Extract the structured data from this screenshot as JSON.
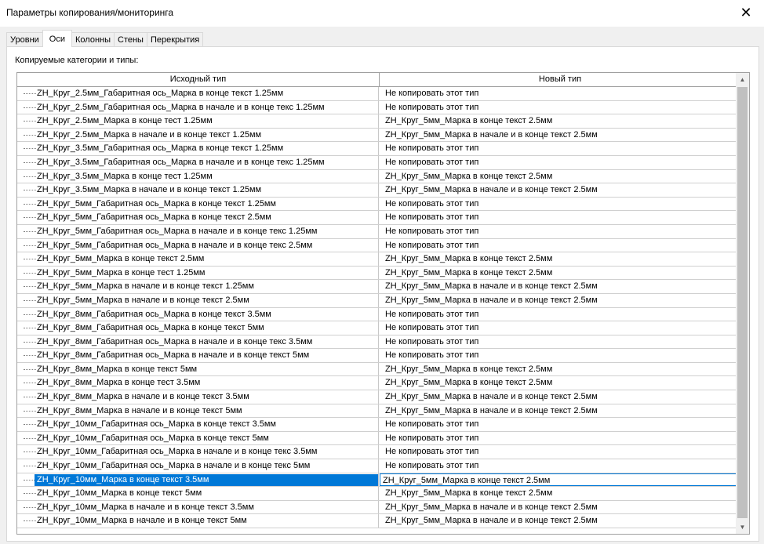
{
  "window": {
    "title": "Параметры копирования/мониторинга",
    "close_glyph": "✕"
  },
  "tabs": [
    {
      "label": "Уровни"
    },
    {
      "label": "Оси"
    },
    {
      "label": "Колонны"
    },
    {
      "label": "Стены"
    },
    {
      "label": "Перекрытия"
    }
  ],
  "active_tab": "Оси",
  "section_label": "Копируемые категории и типы:",
  "grid": {
    "columns": [
      "Исходный тип",
      "Новый тип"
    ],
    "rows": [
      [
        "ZH_Круг_2.5мм_Габаритная ось_Марка в конце текст 1.25мм",
        "Не копировать этот тип"
      ],
      [
        "ZH_Круг_2.5мм_Габаритная ось_Марка в начале и в конце текс 1.25мм",
        "Не копировать этот тип"
      ],
      [
        "ZH_Круг_2.5мм_Марка в конце тест 1.25мм",
        "ZH_Круг_5мм_Марка в конце текст 2.5мм"
      ],
      [
        "ZH_Круг_2.5мм_Марка в начале и в конце текст 1.25мм",
        "ZH_Круг_5мм_Марка в начале и в конце текст 2.5мм"
      ],
      [
        "ZH_Круг_3.5мм_Габаритная ось_Марка в конце текст 1.25мм",
        "Не копировать этот тип"
      ],
      [
        "ZH_Круг_3.5мм_Габаритная ось_Марка в начале и в конце текс 1.25мм",
        "Не копировать этот тип"
      ],
      [
        "ZH_Круг_3.5мм_Марка в конце тест 1.25мм",
        "ZH_Круг_5мм_Марка в конце текст 2.5мм"
      ],
      [
        "ZH_Круг_3.5мм_Марка в начале и в конце текст 1.25мм",
        "ZH_Круг_5мм_Марка в начале и в конце текст 2.5мм"
      ],
      [
        "ZH_Круг_5мм_Габаритная ось_Марка в конце текст 1.25мм",
        "Не копировать этот тип"
      ],
      [
        "ZH_Круг_5мм_Габаритная ось_Марка в конце текст 2.5мм",
        "Не копировать этот тип"
      ],
      [
        "ZH_Круг_5мм_Габаритная ось_Марка в начале и в конце текс 1.25мм",
        "Не копировать этот тип"
      ],
      [
        "ZH_Круг_5мм_Габаритная ось_Марка в начале и в конце текс 2.5мм",
        "Не копировать этот тип"
      ],
      [
        "ZH_Круг_5мм_Марка в конце текст 2.5мм",
        "ZH_Круг_5мм_Марка в конце текст 2.5мм"
      ],
      [
        "ZH_Круг_5мм_Марка в конце тест 1.25мм",
        "ZH_Круг_5мм_Марка в конце текст 2.5мм"
      ],
      [
        "ZH_Круг_5мм_Марка в начале и в конце текст 1.25мм",
        "ZH_Круг_5мм_Марка в начале и в конце текст 2.5мм"
      ],
      [
        "ZH_Круг_5мм_Марка в начале и в конце текст 2.5мм",
        "ZH_Круг_5мм_Марка в начале и в конце текст 2.5мм"
      ],
      [
        "ZH_Круг_8мм_Габаритная ось_Марка в конце текст 3.5мм",
        "Не копировать этот тип"
      ],
      [
        "ZH_Круг_8мм_Габаритная ось_Марка в конце текст 5мм",
        "Не копировать этот тип"
      ],
      [
        "ZH_Круг_8мм_Габаритная ось_Марка в начале и в конце текс 3.5мм",
        "Не копировать этот тип"
      ],
      [
        "ZH_Круг_8мм_Габаритная ось_Марка в начале и в конце текст 5мм",
        "Не копировать этот тип"
      ],
      [
        "ZH_Круг_8мм_Марка в конце текст 5мм",
        "ZH_Круг_5мм_Марка в конце текст 2.5мм"
      ],
      [
        "ZH_Круг_8мм_Марка в конце тест 3.5мм",
        "ZH_Круг_5мм_Марка в конце текст 2.5мм"
      ],
      [
        "ZH_Круг_8мм_Марка в начале и в конце текст 3.5мм",
        "ZH_Круг_5мм_Марка в начале и в конце текст 2.5мм"
      ],
      [
        "ZH_Круг_8мм_Марка в начале и в конце текст 5мм",
        "ZH_Круг_5мм_Марка в начале и в конце текст 2.5мм"
      ],
      [
        "ZH_Круг_10мм_Габаритная ось_Марка в конце текст 3.5мм",
        "Не копировать этот тип"
      ],
      [
        "ZH_Круг_10мм_Габаритная ось_Марка в конце текст 5мм",
        "Не копировать этот тип"
      ],
      [
        "ZH_Круг_10мм_Габаритная ось_Марка в начале и в конце текс 3.5мм",
        "Не копировать этот тип"
      ],
      [
        "ZH_Круг_10мм_Габаритная ось_Марка в начале и в конце текс 5мм",
        "Не копировать этот тип"
      ],
      [
        "ZH_Круг_10мм_Марка в конце текст 3.5мм",
        "ZH_Круг_5мм_Марка в конце текст 2.5мм"
      ],
      [
        "ZH_Круг_10мм_Марка в конце текст 5мм",
        "ZH_Круг_5мм_Марка в конце текст 2.5мм"
      ],
      [
        "ZH_Круг_10мм_Марка в начале и в конце текст 3.5мм",
        "ZH_Круг_5мм_Марка в начале и в конце текст 2.5мм"
      ],
      [
        "ZH_Круг_10мм_Марка в начале и в конце текст 5мм",
        "ZH_Круг_5мм_Марка в начале и в конце текст 2.5мм"
      ]
    ],
    "selected_source": "ZH_Круг_10мм_Марка в конце текст 3.5мм"
  },
  "icons": {
    "scroll_up": "chevron-up-icon",
    "scroll_down": "chevron-down-icon"
  },
  "colors": {
    "selection": "#0078d7",
    "window_bg": "#f0f0f0"
  }
}
